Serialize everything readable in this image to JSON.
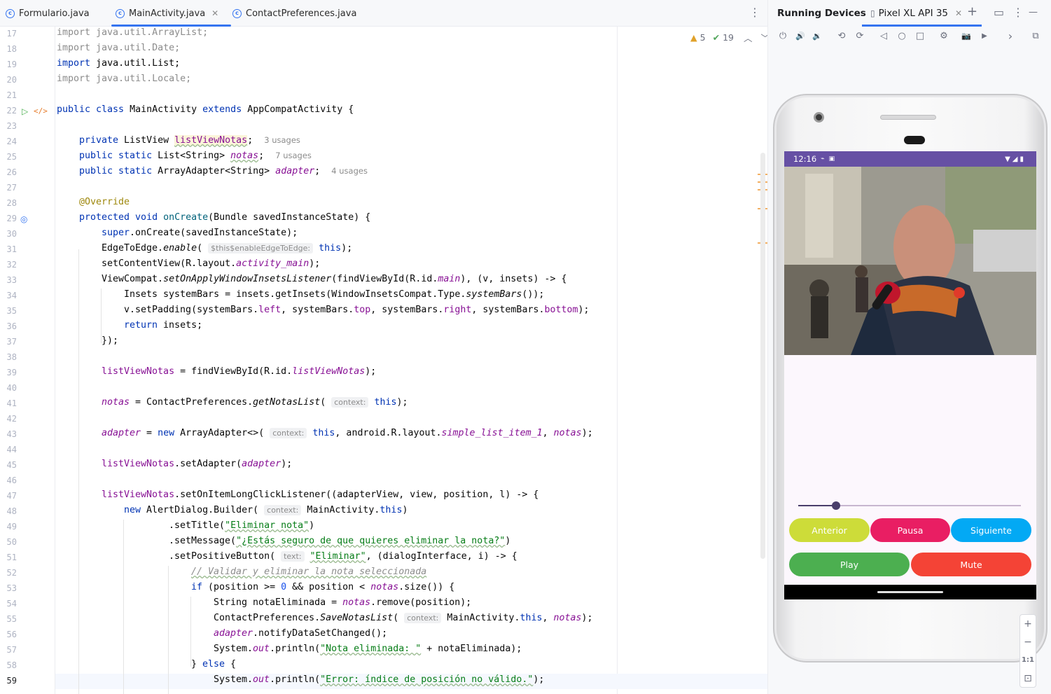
{
  "tabs": [
    {
      "label": "Formulario.java",
      "active": false,
      "icon": "class-icon"
    },
    {
      "label": "MainActivity.java",
      "active": true,
      "icon": "class-icon"
    },
    {
      "label": "ContactPreferences.java",
      "active": false,
      "icon": "class-icon"
    }
  ],
  "class_icon_glyph": "c",
  "close_glyph": "✕",
  "more_glyph": "⋮",
  "inspections": {
    "warnings": "5",
    "ok": "19"
  },
  "lines": [
    "17",
    "18",
    "19",
    "20",
    "21",
    "22",
    "23",
    "24",
    "25",
    "26",
    "27",
    "28",
    "29",
    "30",
    "31",
    "32",
    "33",
    "34",
    "35",
    "36",
    "37",
    "38",
    "39",
    "40",
    "41",
    "42",
    "43",
    "44",
    "45",
    "46",
    "47",
    "48",
    "49",
    "50",
    "51",
    "52",
    "53",
    "54",
    "55",
    "56",
    "57",
    "58",
    "59"
  ],
  "code": {
    "l17": "import java.util.ArrayList;",
    "l18": "import java.util.Date;",
    "l19a": "import",
    "l19b": " java.util.List;",
    "l20": "import java.util.Locale;",
    "l22a": "public class",
    "l22b": " MainActivity ",
    "l22c": "extends",
    "l22d": " AppCompatActivity {",
    "l24a": "private",
    "l24b": " ListView ",
    "l24c": "listViewNotas",
    "l24d": ";",
    "l24u": "3 usages",
    "l25a": "public static",
    "l25b": " List<String> ",
    "l25c": "notas",
    "l25d": ";",
    "l25u": "7 usages",
    "l26a": "public static",
    "l26b": " ArrayAdapter<String> ",
    "l26c": "adapter",
    "l26d": ";",
    "l26u": "4 usages",
    "l28": "@Override",
    "l29a": "protected void",
    "l29b": " onCreate",
    "l29c": "(Bundle savedInstanceState) {",
    "l30a": "super",
    "l30b": ".onCreate(savedInstanceState);",
    "l31a": "EdgeToEdge.",
    "l31b": "enable",
    "l31c": "( ",
    "l31h": "$this$enableEdgeToEdge:",
    "l31d": "this",
    "l31e": ");",
    "l32a": "setContentView(R.layout.",
    "l32b": "activity_main",
    "l32c": ");",
    "l33a": "ViewCompat.",
    "l33b": "setOnApplyWindowInsetsListener",
    "l33c": "(findViewById(R.id.",
    "l33d": "main",
    "l33e": "), (v, insets) -> {",
    "l34a": "Insets systemBars = insets.getInsets(WindowInsetsCompat.Type.",
    "l34b": "systemBars",
    "l34c": "());",
    "l35a": "v.setPadding(systemBars.",
    "l35b": "left",
    "l35c": ", systemBars.",
    "l35d": "top",
    "l35e": ", systemBars.",
    "l35f": "right",
    "l35g": ", systemBars.",
    "l35h": "bottom",
    "l35i": ");",
    "l36a": "return",
    "l36b": " insets;",
    "l37": "});",
    "l39a": "listViewNotas",
    "l39b": " = findViewById(R.id.",
    "l39c": "listViewNotas",
    "l39d": ");",
    "l41a": "notas",
    "l41b": " = ContactPreferences.",
    "l41c": "getNotasList",
    "l41d": "( ",
    "l41h": "context:",
    "l41e": "this",
    "l41f": ");",
    "l43a": "adapter",
    "l43b": " = ",
    "l43c": "new",
    "l43d": " ArrayAdapter<>( ",
    "l43h": "context:",
    "l43e": "this",
    "l43f": ", android.R.layout.",
    "l43g": "simple_list_item_1",
    "l43i": ", ",
    "l43j": "notas",
    "l43k": ");",
    "l45a": "listViewNotas",
    "l45b": ".setAdapter(",
    "l45c": "adapter",
    "l45d": ");",
    "l47a": "listViewNotas",
    "l47b": ".setOnItemLongClickListener((adapterView, view, position, l) -> {",
    "l48a": "new",
    "l48b": " AlertDialog.Builder( ",
    "l48h": "context:",
    "l48c": "MainActivity.",
    "l48d": "this",
    "l48e": ")",
    "l49a": ".setTitle(",
    "l49b": "\"Eliminar nota\"",
    "l49c": ")",
    "l50a": ".setMessage(",
    "l50b": "\"¿Estás seguro de que quieres eliminar la nota?\"",
    "l50c": ")",
    "l51a": ".setPositiveButton( ",
    "l51h": "text:",
    "l51b": "\"Eliminar\"",
    "l51c": ", (dialogInterface, i) -> {",
    "l52": "// Validar y eliminar la nota seleccionada",
    "l53a": "if",
    "l53b": " (position >= ",
    "l53c": "0",
    "l53d": " && position < ",
    "l53e": "notas",
    "l53f": ".size()) {",
    "l54a": "String notaEliminada = ",
    "l54b": "notas",
    "l54c": ".remove(position);",
    "l55a": "ContactPreferences.",
    "l55b": "SaveNotasList",
    "l55c": "( ",
    "l55h": "context:",
    "l55d": "MainActivity.",
    "l55e": "this",
    "l55f": ", ",
    "l55g": "notas",
    "l55i": ");",
    "l56a": "adapter",
    "l56b": ".notifyDataSetChanged();",
    "l57a": "System.",
    "l57b": "out",
    "l57c": ".println(",
    "l57d": "\"Nota eliminada: \"",
    "l57e": " + notaEliminada);",
    "l58a": "} ",
    "l58b": "else",
    "l58c": " {",
    "l59a": "System.",
    "l59b": "out",
    "l59c": ".println(",
    "l59d": "\"Error: índice de posición no válido.\"",
    "l59e": ");"
  },
  "panel": {
    "title": "Running Devices",
    "device_tab": "Pixel XL API 35",
    "add_glyph": "+",
    "window_glyph": "▭",
    "minimize_glyph": "—"
  },
  "toolbar_icons": [
    "power-icon",
    "volume-up-icon",
    "volume-down-icon",
    "rotate-left-icon",
    "rotate-right-icon",
    "back-icon",
    "home-icon",
    "overview-icon",
    "device-settings-icon",
    "screenshot-icon",
    "screen-record-icon",
    "expand-icon",
    "window-icon"
  ],
  "toolbar_glyphs": {
    "power": "⏻",
    "volup": "🔊",
    "voldown": "🔉",
    "rotl": "⟲",
    "rotr": "⟳",
    "back": "◁",
    "home": "○",
    "overview": "□",
    "settings": "⚙",
    "camera": "📷",
    "record": "▶",
    "chevron": "›",
    "windows": "⧉"
  },
  "device": {
    "time": "12:16",
    "buttons": [
      {
        "label": "Anterior",
        "color": "#cddc39"
      },
      {
        "label": "Pausa",
        "color": "#e91e63"
      },
      {
        "label": "Siguiente",
        "color": "#03a9f4"
      },
      {
        "label": "Play",
        "color": "#4caf50"
      },
      {
        "label": "Mute",
        "color": "#f44336"
      }
    ],
    "seek_progress": 0.17
  },
  "zoom": {
    "in": "+",
    "out": "−",
    "ratio": "1:1",
    "fit": "⊡"
  }
}
